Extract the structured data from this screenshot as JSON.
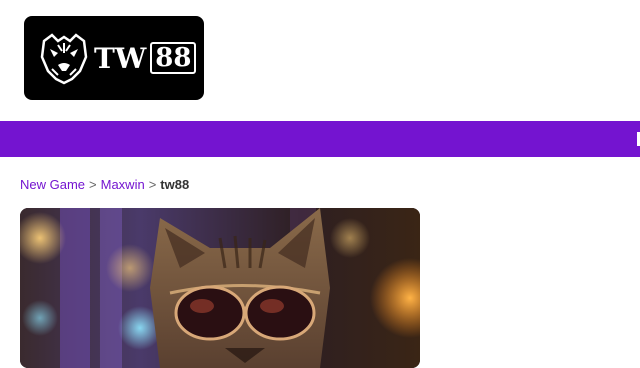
{
  "header": {
    "logo": {
      "brand_text": "TW",
      "brand_number": "88",
      "icon": "tiger-head-icon",
      "background": "#000000"
    }
  },
  "navbar": {
    "color": "#7414d0"
  },
  "breadcrumb": {
    "items": [
      {
        "label": "New Game"
      },
      {
        "label": "Maxwin"
      }
    ],
    "separator": ">",
    "current": "tw88"
  },
  "hero": {
    "image": "cat-with-sunglasses-image"
  },
  "colors": {
    "accent": "#7414d0",
    "link": "#7414d0"
  }
}
